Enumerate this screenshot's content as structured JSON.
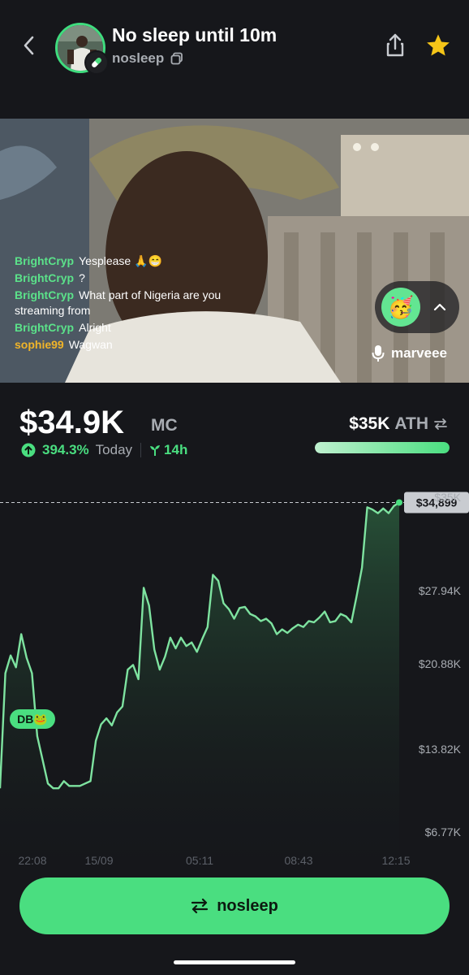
{
  "header": {
    "title": "No sleep until 10m",
    "handle": "nosleep",
    "icons": {
      "back": "chevron-left-icon",
      "share": "share-icon",
      "favorite": "star-icon",
      "copy": "copy-icon",
      "badge": "pill-icon"
    },
    "colors": {
      "accent": "#4ade80",
      "star": "#f5c518"
    }
  },
  "stream": {
    "chat": [
      {
        "user": "BrightCryp",
        "text": "Yesplease 🙏😁"
      },
      {
        "user": "BrightCryp",
        "text": "?"
      },
      {
        "user": "BrightCryp",
        "text": "What part of Nigeria are you streaming from"
      },
      {
        "user": "BrightCryp",
        "text": "Alright"
      },
      {
        "user": "sophie99",
        "text": "Wagwan"
      }
    ],
    "reaction_emoji": "🥳",
    "host_name": "marveee"
  },
  "stats": {
    "market_cap": "$34.9K",
    "market_cap_label": "MC",
    "change_pct": "394.3%",
    "change_period": "Today",
    "age": "14h",
    "ath_value": "$35K",
    "ath_label": "ATH",
    "ath_progress": 0.997
  },
  "chart_data": {
    "type": "area",
    "x_ticks": [
      "22:08",
      "15/09",
      "05:11",
      "08:43",
      "12:15"
    ],
    "y_ticks": [
      "$35K",
      "$27.94K",
      "$20.88K",
      "$13.82K",
      "$6.77K"
    ],
    "ylim": [
      6770,
      35000
    ],
    "current_label": "$34,899",
    "current_value": 34899,
    "marker_label": "DB🐸",
    "x_label": "",
    "y_label": "",
    "values": [
      10800,
      20500,
      22000,
      21000,
      23800,
      21800,
      20500,
      15200,
      13200,
      11200,
      10800,
      10800,
      11400,
      11000,
      11000,
      11000,
      11200,
      11400,
      14800,
      16200,
      16700,
      16100,
      17200,
      17700,
      20800,
      21200,
      20000,
      27700,
      26200,
      22500,
      20800,
      21900,
      23500,
      22600,
      23500,
      22800,
      23100,
      22300,
      23400,
      24400,
      28800,
      28300,
      26400,
      25900,
      25100,
      26000,
      26100,
      25500,
      25300,
      24900,
      25100,
      24700,
      23800,
      24200,
      23900,
      24300,
      24600,
      24400,
      24900,
      24800,
      25200,
      25700,
      24800,
      24900,
      25500,
      25300,
      24800,
      27000,
      29400,
      34500,
      34300,
      34000,
      34400,
      34000,
      34600,
      34899
    ],
    "colors": {
      "line": "#7ee3a0",
      "up": "#4ade80"
    }
  },
  "cta": {
    "label": "nosleep",
    "icon": "swap-icon"
  }
}
